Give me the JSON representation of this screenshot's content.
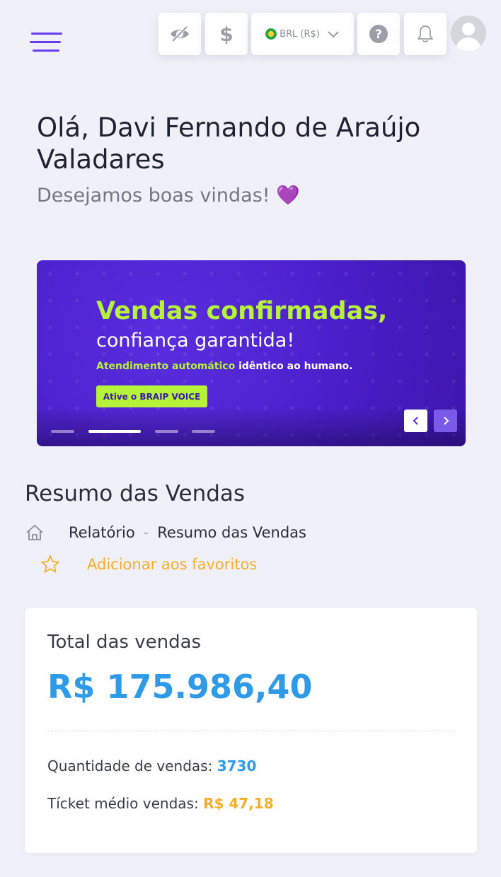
{
  "header": {
    "menu_icon": "hamburger-menu-icon",
    "hide_values_icon": "eye-slash-icon",
    "currency_symbol": "$",
    "currency_label": "BRL (R$)",
    "help_icon": "question-circle-icon",
    "notifications_icon": "bell-icon",
    "avatar_icon": "user-avatar-icon"
  },
  "greeting": {
    "title": "Olá, Davi Fernando de Araújo Valadares",
    "subtitle": "Desejamos boas vindas!",
    "emoji": "💜"
  },
  "banner": {
    "headline": "Vendas confirmadas,",
    "subheadline": "confiança garantida!",
    "line_highlight": "Atendimento automático",
    "line_rest": " idêntico ao humano.",
    "cta_prefix": "Ative o ",
    "cta_bold": "BRAIP VOICE",
    "slide_count": 4,
    "active_slide": 2,
    "prev_icon": "chevron-left-icon",
    "next_icon": "chevron-right-icon"
  },
  "section": {
    "title": "Resumo das Vendas",
    "breadcrumb": [
      "Relatório",
      "Resumo das Vendas"
    ],
    "breadcrumb_separator": "-",
    "favorite_label": "Adicionar aos favoritos"
  },
  "summary": {
    "total_label": "Total das vendas",
    "total_value": "R$ 175.986,40",
    "quantity_label": "Quantidade de vendas: ",
    "quantity_value": "3730",
    "ticket_label": "Tícket médio vendas: ",
    "ticket_value": "R$ 47,18"
  },
  "colors": {
    "accent_purple": "#6a3df0",
    "banner_green": "#b7f23a",
    "value_blue": "#2f9be8",
    "value_orange": "#f6ad2a",
    "background": "#f0f1f8"
  }
}
